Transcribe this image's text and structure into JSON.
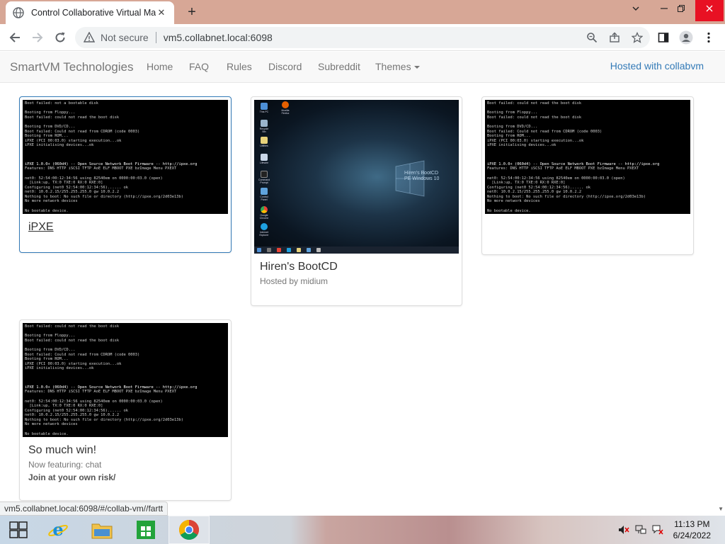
{
  "browser": {
    "tab_title": "Control Collaborative Virtual Ma",
    "tab_close": "✕",
    "new_tab": "+",
    "secure_label": "Not secure",
    "url": "vm5.collabnet.local:6098",
    "status_url": "vm5.collabnet.local:6098/#/collab-vm//fartt"
  },
  "navbar": {
    "brand": "SmartVM Technologies",
    "links": [
      "Home",
      "FAQ",
      "Rules",
      "Discord",
      "Subreddit",
      "Themes"
    ],
    "hosted": "Hosted with collabvm"
  },
  "cards": [
    {
      "title": "iPXE",
      "terminal": [
        "Boot failed: not a bootable disk",
        "",
        "Booting from Floppy...",
        "Boot failed: could not read the boot disk",
        "",
        "Booting from DVD/CD...",
        "Boot failed: Could not read from CDROM (code 0003)",
        "Booting from ROM...",
        "iPXE (PCI 00:03.0) starting execution...ok",
        "iPXE initialising devices...ok",
        "",
        "",
        "",
        "iPXE 1.0.0+ (060d4) -- Open Source Network Boot Firmware -- http://ipxe.org",
        "Features: DNS HTTP iSCSI TFTP AoE ELF MBOOT PXE bzImage Menu PXEXT",
        "",
        "net0: 52:54:00:12:34:56 using 82540em on 0000:00:03.0 (open)",
        "  [Link:up, TX:0 TXE:0 RX:0 RXE:0]",
        "Configuring (net0 52:54:00:12:34:56)...... ok",
        "net0: 10.0.2.15/255.255.255.0 gw 10.0.2.2",
        "Nothing to boot: No such file or directory (http://ipxe.org/2d03e13b)",
        "No more network devices",
        "",
        "No bootable device."
      ]
    },
    {
      "title": "Hiren's BootCD",
      "subtitle": "Hosted by midium",
      "desktop_icons": [
        "This PC",
        "Recycle Bin",
        "Utilities",
        "Lifewire",
        "Command Prompt",
        "Control Panel",
        "Google Chrome",
        "Internet Explorer"
      ],
      "desktop_top_icon": "Mozilla Firefox",
      "logo_text": [
        "Hiren's BootCD",
        "PE Windows 10"
      ]
    },
    {
      "terminal": [
        "Boot failed: could not read the boot disk",
        "",
        "Booting from Floppy...",
        "Boot failed: could not read the boot disk",
        "",
        "Booting from DVD/CD...",
        "Boot failed: Could not read from CDROM (code 0003)",
        "Booting from ROM...",
        "iPXE (PCI 00:03.0) starting execution...ok",
        "iPXE initialising devices...ok",
        "",
        "",
        "",
        "iPXE 1.0.0+ (060d4) -- Open Source Network Boot Firmware -- http://ipxe.org",
        "Features: DNS HTTP iSCSI TFTP AoE ELF MBOOT PXE bzImage Menu PXEXT",
        "",
        "net0: 52:54:00:12:34:56 using 82540em on 0000:00:03.0 (open)",
        "  [Link:up, TX:0 TXE:0 RX:0 RXE:0]",
        "Configuring (net0 52:54:00:12:34:56)...... ok",
        "net0: 10.0.2.15/255.255.255.0 gw 10.0.2.2",
        "Nothing to boot: No such file or directory (http://ipxe.org/2d03e13b)",
        "No more network devices",
        "",
        "No bootable device."
      ]
    },
    {
      "title": "So much win!",
      "subtitle": "Now featuring: chat",
      "bold": "Join at your own risk/",
      "terminal": [
        "Boot failed: could not read the boot disk",
        "",
        "Booting from Floppy...",
        "Boot failed: could not read the boot disk",
        "",
        "Booting from DVD/CD...",
        "Boot failed: Could not read from CDROM (code 0003)",
        "Booting from ROM...",
        "iPXE (PCI 00:03.0) starting execution...ok",
        "iPXE initialising devices...ok",
        "",
        "",
        "",
        "iPXE 1.0.0+ (060d4) -- Open Source Network Boot Firmware -- http://ipxe.org",
        "Features: DNS HTTP iSCSI TFTP AoE ELF MBOOT PXE bzImage Menu PXEXT",
        "",
        "net0: 52:54:00:12:34:56 using 82540em on 0000:00:03.0 (open)",
        "  [Link:up, TX:0 TXE:0 RX:0 RXE:0]",
        "Configuring (net0 52:54:00:12:34:56)...... ok",
        "net0: 10.0.2.15/255.255.255.0 gw 10.0.2.2",
        "Nothing to boot: No such file or directory (http://ipxe.org/2d03e13b)",
        "No more network devices",
        "",
        "No bootable device."
      ]
    }
  ],
  "taskbar": {
    "time": "11:13 PM",
    "date": "6/24/2022"
  },
  "colors": {
    "tab_strip": "#d7a796",
    "link": "#337ab7",
    "navbar_bg": "#f8f8f8"
  }
}
